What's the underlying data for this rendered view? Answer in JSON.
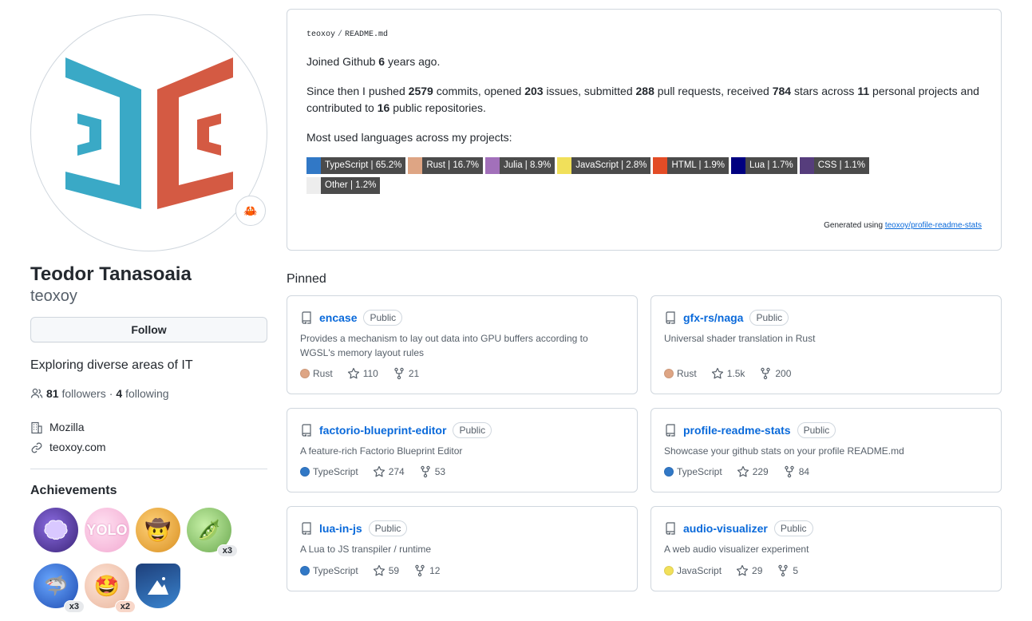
{
  "profile": {
    "name": "Teodor Tanasoaia",
    "username": "teoxoy",
    "follow_label": "Follow",
    "bio": "Exploring diverse areas of IT",
    "followers_count": "81",
    "followers_label": "followers",
    "separator": "·",
    "following_count": "4",
    "following_label": "following",
    "company": "Mozilla",
    "website": "teoxoy.com",
    "status_icon": "crab-emoji",
    "achievements_title": "Achievements",
    "achievements": [
      {
        "name": "galaxy-brain",
        "color": "#5a3e9e",
        "count": ""
      },
      {
        "name": "yolo",
        "color": "#f6b7d9",
        "count": ""
      },
      {
        "name": "quickdraw",
        "color": "#e8a23b",
        "count": ""
      },
      {
        "name": "pair-extraordinaire",
        "color": "#8bc96a",
        "count": "x3"
      },
      {
        "name": "pull-shark",
        "color": "#2f5fd1",
        "count": "x3"
      },
      {
        "name": "starstruck",
        "color": "#f3c9b6",
        "count": "x2"
      },
      {
        "name": "arctic-code-vault-contributor",
        "color": "#1c5fa8",
        "count": ""
      }
    ]
  },
  "readme": {
    "owner": "teoxoy",
    "slash": "/",
    "file": "README.md",
    "joined_pre": "Joined Github ",
    "joined_years": "6",
    "joined_post": " years ago.",
    "s_pre": "Since then I pushed ",
    "commits": "2579",
    "s_commits": " commits, opened ",
    "issues": "203",
    "s_issues": " issues, submitted ",
    "prs": "288",
    "s_prs": " pull requests, received ",
    "stars": "784",
    "s_stars": " stars across ",
    "projects": "11",
    "s_projects": " personal projects and contributed to ",
    "repos": "16",
    "s_repos": " public repositories.",
    "languages_intro": "Most used languages across my projects:",
    "languages": [
      {
        "label": "TypeScript | 65.2%",
        "color": "#3178c6"
      },
      {
        "label": "Rust | 16.7%",
        "color": "#dea584"
      },
      {
        "label": "Julia | 8.9%",
        "color": "#a270ba"
      },
      {
        "label": "JavaScript | 2.8%",
        "color": "#f1e05a"
      },
      {
        "label": "HTML | 1.9%",
        "color": "#e34c26"
      },
      {
        "label": "Lua | 1.7%",
        "color": "#000080"
      },
      {
        "label": "CSS | 1.1%",
        "color": "#563d7c"
      },
      {
        "label": "Other | 1.2%",
        "color": "#ededed"
      }
    ],
    "generated_text": "Generated using ",
    "generated_link": "teoxoy/profile-readme-stats"
  },
  "pinned": {
    "title": "Pinned",
    "repos": [
      {
        "name": "encase",
        "visibility": "Public",
        "description": "Provides a mechanism to lay out data into GPU buffers according to WGSL's memory layout rules",
        "language": "Rust",
        "language_color": "#dea584",
        "stars": "110",
        "forks": "21"
      },
      {
        "name": "gfx-rs/naga",
        "visibility": "Public",
        "description": "Universal shader translation in Rust",
        "language": "Rust",
        "language_color": "#dea584",
        "stars": "1.5k",
        "forks": "200"
      },
      {
        "name": "factorio-blueprint-editor",
        "visibility": "Public",
        "description": "A feature-rich Factorio Blueprint Editor",
        "language": "TypeScript",
        "language_color": "#3178c6",
        "stars": "274",
        "forks": "53"
      },
      {
        "name": "profile-readme-stats",
        "visibility": "Public",
        "description": "Showcase your github stats on your profile README.md",
        "language": "TypeScript",
        "language_color": "#3178c6",
        "stars": "229",
        "forks": "84"
      },
      {
        "name": "lua-in-js",
        "visibility": "Public",
        "description": "A Lua to JS transpiler / runtime",
        "language": "TypeScript",
        "language_color": "#3178c6",
        "stars": "59",
        "forks": "12"
      },
      {
        "name": "audio-visualizer",
        "visibility": "Public",
        "description": "A web audio visualizer experiment",
        "language": "JavaScript",
        "language_color": "#f1e05a",
        "stars": "29",
        "forks": "5"
      }
    ]
  },
  "colors": {
    "avatar_blue": "#3aa9c6",
    "avatar_red": "#d45a43",
    "link": "#0969da"
  }
}
